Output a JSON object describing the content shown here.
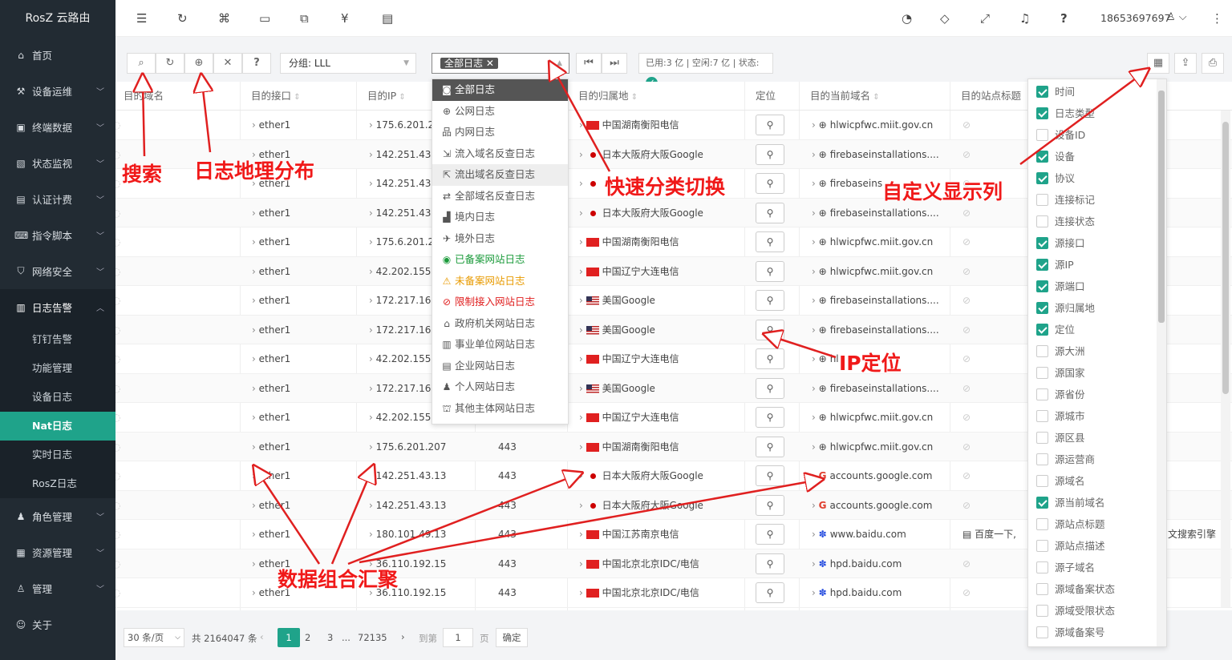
{
  "app": {
    "title": "RosZ 云路由"
  },
  "sidebar": {
    "items": [
      {
        "label": "首页",
        "icon": "home-icon"
      },
      {
        "label": "设备运维",
        "icon": "tools-icon"
      },
      {
        "label": "终端数据",
        "icon": "monitor-icon"
      },
      {
        "label": "状态监视",
        "icon": "chart-icon"
      },
      {
        "label": "认证计费",
        "icon": "billing-icon"
      },
      {
        "label": "指令脚本",
        "icon": "script-icon"
      },
      {
        "label": "网络安全",
        "icon": "shield-icon"
      },
      {
        "label": "日志告警",
        "icon": "log-icon"
      }
    ],
    "subitems": [
      "钉钉告警",
      "功能管理",
      "设备日志",
      "Nat日志",
      "实时日志",
      "RosZ日志"
    ],
    "bottom": [
      {
        "label": "角色管理",
        "icon": "users-icon"
      },
      {
        "label": "资源管理",
        "icon": "resource-icon"
      },
      {
        "label": "管理",
        "icon": "user-icon"
      },
      {
        "label": "关于",
        "icon": "about-icon"
      }
    ]
  },
  "header": {
    "user": "18653697697"
  },
  "toolbar": {
    "group_select": "分组: LLL",
    "log_tag": "全部日志",
    "status_text": "已用:3 亿 | 空闲:7 亿 | 状态:"
  },
  "columns": [
    "目的域名",
    "目的接口",
    "目的IP",
    "目的端口",
    "目的归属地",
    "定位",
    "目的当前域名",
    "目的站点标题"
  ],
  "dropdown": [
    {
      "label": "全部日志",
      "icon": "all-log-icon"
    },
    {
      "label": "公网日志",
      "icon": "globe-icon"
    },
    {
      "label": "内网日志",
      "icon": "lan-icon"
    },
    {
      "label": "流入域名反查日志",
      "icon": "inbound-icon"
    },
    {
      "label": "流出域名反查日志",
      "icon": "outbound-icon"
    },
    {
      "label": "全部域名反查日志",
      "icon": "swap-icon"
    },
    {
      "label": "境内日志",
      "icon": "domestic-icon"
    },
    {
      "label": "境外日志",
      "icon": "plane-icon"
    },
    {
      "label": "已备案网站日志",
      "icon": "registered-icon",
      "color": "#1a9a3a"
    },
    {
      "label": "未备案网站日志",
      "icon": "warning-icon",
      "color": "#e89a00"
    },
    {
      "label": "限制接入网站日志",
      "icon": "ban-icon",
      "color": "#e02020"
    },
    {
      "label": "政府机关网站日志",
      "icon": "gov-icon"
    },
    {
      "label": "事业单位网站日志",
      "icon": "institution-icon"
    },
    {
      "label": "企业网站日志",
      "icon": "enterprise-icon"
    },
    {
      "label": "个人网站日志",
      "icon": "person-icon"
    },
    {
      "label": "其他主体网站日志",
      "icon": "other-icon"
    }
  ],
  "column_panel": [
    {
      "label": "时间",
      "checked": true
    },
    {
      "label": "日志类型",
      "checked": true
    },
    {
      "label": "设备ID",
      "checked": false
    },
    {
      "label": "设备",
      "checked": true
    },
    {
      "label": "协议",
      "checked": true
    },
    {
      "label": "连接标记",
      "checked": false
    },
    {
      "label": "连接状态",
      "checked": false
    },
    {
      "label": "源接口",
      "checked": true
    },
    {
      "label": "源IP",
      "checked": true
    },
    {
      "label": "源端口",
      "checked": true
    },
    {
      "label": "源归属地",
      "checked": true
    },
    {
      "label": "定位",
      "checked": true
    },
    {
      "label": "源大洲",
      "checked": false
    },
    {
      "label": "源国家",
      "checked": false
    },
    {
      "label": "源省份",
      "checked": false
    },
    {
      "label": "源城市",
      "checked": false
    },
    {
      "label": "源区县",
      "checked": false
    },
    {
      "label": "源运营商",
      "checked": false
    },
    {
      "label": "源域名",
      "checked": false
    },
    {
      "label": "源当前域名",
      "checked": true
    },
    {
      "label": "源站点标题",
      "checked": false
    },
    {
      "label": "源站点描述",
      "checked": false
    },
    {
      "label": "源子域名",
      "checked": false
    },
    {
      "label": "源域备案状态",
      "checked": false
    },
    {
      "label": "源域受限状态",
      "checked": false
    },
    {
      "label": "源域备案号",
      "checked": false
    }
  ],
  "rows": [
    {
      "iface": "ether1",
      "ip": "175.6.201.2",
      "port": "",
      "loc": "中国湖南衡阳电信",
      "flag": "cn",
      "domain": "hlwicpfwc.miit.gov.cn",
      "dicon": "globe"
    },
    {
      "iface": "ether1",
      "ip": "142.251.43.",
      "port": "",
      "loc": "日本大阪府大阪Google",
      "flag": "jp",
      "domain": "firebaseinstallations....",
      "dicon": "globe"
    },
    {
      "iface": "ether1",
      "ip": "142.251.43.",
      "port": "",
      "loc": "",
      "flag": "jp",
      "domain": "firebaseins",
      "dicon": "globe"
    },
    {
      "iface": "ether1",
      "ip": "142.251.43.",
      "port": "",
      "loc": "日本大阪府大阪Google",
      "flag": "jp",
      "domain": "firebaseinstallations....",
      "dicon": "globe"
    },
    {
      "iface": "ether1",
      "ip": "175.6.201.2",
      "port": "",
      "loc": "中国湖南衡阳电信",
      "flag": "cn",
      "domain": "hlwicpfwc.miit.gov.cn",
      "dicon": "globe"
    },
    {
      "iface": "ether1",
      "ip": "42.202.155.",
      "port": "",
      "loc": "中国辽宁大连电信",
      "flag": "cn",
      "domain": "hlwicpfwc.miit.gov.cn",
      "dicon": "globe"
    },
    {
      "iface": "ether1",
      "ip": "172.217.16",
      "port": "",
      "loc": "美国Google",
      "flag": "us",
      "domain": "firebaseinstallations....",
      "dicon": "globe"
    },
    {
      "iface": "ether1",
      "ip": "172.217.16",
      "port": "",
      "loc": "美国Google",
      "flag": "us",
      "domain": "firebaseinstallations....",
      "dicon": "globe"
    },
    {
      "iface": "ether1",
      "ip": "42.202.155.",
      "port": "",
      "loc": "中国辽宁大连电信",
      "flag": "cn",
      "domain": "hl",
      "dicon": "globe"
    },
    {
      "iface": "ether1",
      "ip": "172.217.16",
      "port": "",
      "loc": "美国Google",
      "flag": "us",
      "domain": "firebaseinstallations....",
      "dicon": "globe"
    },
    {
      "iface": "ether1",
      "ip": "42.202.155.",
      "port": "",
      "loc": "中国辽宁大连电信",
      "flag": "cn",
      "domain": "hlwicpfwc.miit.gov.cn",
      "dicon": "globe"
    },
    {
      "iface": "ether1",
      "ip": "175.6.201.207",
      "port": "443",
      "loc": "中国湖南衡阳电信",
      "flag": "cn",
      "domain": "hlwicpfwc.miit.gov.cn",
      "dicon": "globe"
    },
    {
      "iface": "ether1",
      "ip": "142.251.43.13",
      "port": "443",
      "loc": "日本大阪府大阪Google",
      "flag": "jp",
      "domain": "accounts.google.com",
      "dicon": "google"
    },
    {
      "iface": "ether1",
      "ip": "142.251.43.13",
      "port": "443",
      "loc": "日本大阪府大阪Google",
      "flag": "jp",
      "domain": "accounts.google.com",
      "dicon": "google"
    },
    {
      "iface": "ether1",
      "ip": "180.101.49.13",
      "port": "443",
      "loc": "中国江苏南京电信",
      "flag": "cn",
      "domain": "www.baidu.com",
      "dicon": "baidu",
      "title": "百度一下,"
    },
    {
      "iface": "ether1",
      "ip": "36.110.192.15",
      "port": "443",
      "loc": "中国北京北京IDC/电信",
      "flag": "cn",
      "domain": "hpd.baidu.com",
      "dicon": "baidu"
    },
    {
      "iface": "ether1",
      "ip": "36.110.192.15",
      "port": "443",
      "loc": "中国北京北京IDC/电信",
      "flag": "cn",
      "domain": "hpd.baidu.com",
      "dicon": "baidu"
    }
  ],
  "partial_col_text": "文搜索引擎",
  "pager": {
    "page_size": "30 条/页",
    "total": "共 2164047 条",
    "pages": [
      "1",
      "2",
      "3",
      "...",
      "72135"
    ],
    "goto": "到第",
    "goto_value": "1",
    "page_unit": "页",
    "confirm": "确定"
  },
  "annotations": {
    "search": "搜索",
    "geo": "日志地理分布",
    "switch": "快速分类切换",
    "columns": "自定义显示列",
    "ipgeo": "IP定位",
    "aggregate": "数据组合汇聚"
  }
}
